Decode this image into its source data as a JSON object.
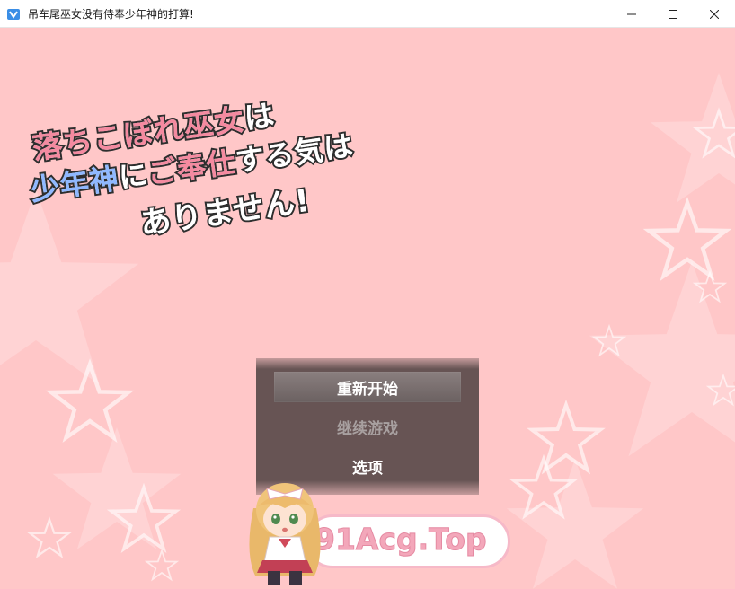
{
  "window": {
    "title": "吊车尾巫女没有侍奉少年神的打算!",
    "app_icon": "game-app-icon",
    "controls": [
      "minimize-icon",
      "maximize-icon",
      "close-icon"
    ]
  },
  "logo": {
    "line1_a": "落ちこぼれ巫女",
    "line1_b": "は",
    "line2_a": "少年神",
    "line2_b": "に",
    "line2_c": "ご奉仕",
    "line2_d": "する気は",
    "line3": "ありません!"
  },
  "menu": {
    "items": [
      {
        "label": "重新开始",
        "state": "selected"
      },
      {
        "label": "继续游戏",
        "state": "disabled"
      },
      {
        "label": "选项",
        "state": "normal"
      }
    ]
  },
  "watermark": {
    "text": "91Acg.Top"
  },
  "colors": {
    "background": "#ffc7c8",
    "menu_panel": "#5f4e4e",
    "logo_pink": "#f48aa0",
    "logo_blue": "#8fb8ff"
  }
}
